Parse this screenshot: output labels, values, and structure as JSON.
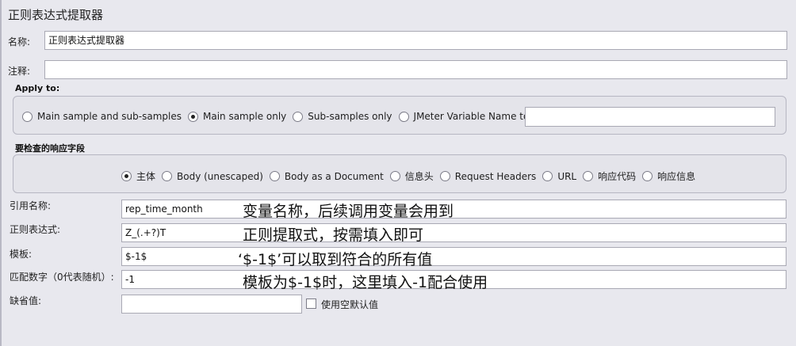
{
  "panel_title": "正则表达式提取器",
  "name": {
    "label": "名称:",
    "value": "正则表达式提取器"
  },
  "comment": {
    "label": "注释:",
    "value": ""
  },
  "apply_to": {
    "title": "Apply to:",
    "options": [
      "Main sample and sub-samples",
      "Main sample only",
      "Sub-samples only",
      "JMeter Variable Name to use"
    ],
    "selected": "Main sample only",
    "variable_value": ""
  },
  "response_field": {
    "title": "要检查的响应字段",
    "options": [
      "主体",
      "Body (unescaped)",
      "Body as a Document",
      "信息头",
      "Request Headers",
      "URL",
      "响应代码",
      "响应信息"
    ],
    "selected": "主体"
  },
  "ref_name": {
    "label": "引用名称:",
    "value": "rep_time_month",
    "note": "变量名称，后续调用变量会用到"
  },
  "regex": {
    "label": "正则表达式:",
    "value": "Z_(.+?)T",
    "note": "正则提取式，按需填入即可"
  },
  "template": {
    "label": "模板:",
    "value": "$-1$",
    "note": "‘$-1$’可以取到符合的所有值"
  },
  "match_no": {
    "label": "匹配数字（0代表随机）:",
    "value": "-1",
    "note": "模板为$-1$时，这里填入-1配合使用"
  },
  "default_value": {
    "label": "缺省值:",
    "value": "",
    "checkbox_label": "使用空默认值",
    "checked": false
  }
}
